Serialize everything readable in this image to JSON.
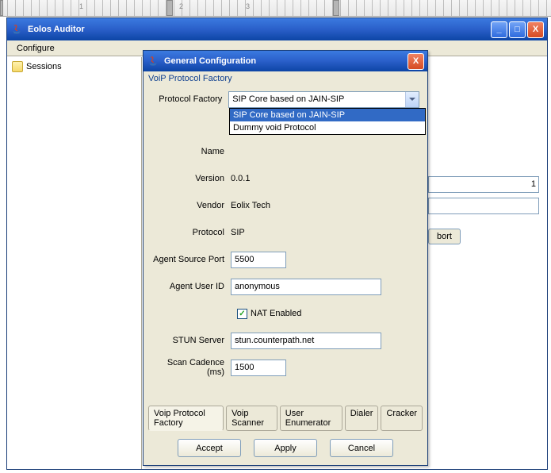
{
  "app": {
    "title": "Eolos Auditor",
    "menu": {
      "configure": "Configure"
    }
  },
  "tree": {
    "sessions": "Sessions"
  },
  "dialog": {
    "title": "General Configuration",
    "group": "VoiP Protocol Factory",
    "labels": {
      "protocol_factory": "Protocol Factory",
      "name": "Name",
      "version": "Version",
      "vendor": "Vendor",
      "protocol": "Protocol",
      "agent_source_port": "Agent Source Port",
      "agent_user_id": "Agent User ID",
      "nat_enabled": "NAT Enabled",
      "stun_server": "STUN Server",
      "scan_cadence": "Scan Cadence (ms)"
    },
    "values": {
      "protocol_factory": "SIP Core based on JAIN-SIP",
      "version": "0.0.1",
      "vendor": "Eolix Tech",
      "protocol": "SIP",
      "agent_source_port": "5500",
      "agent_user_id": "anonymous",
      "nat_enabled": true,
      "stun_server": "stun.counterpath.net",
      "scan_cadence": "1500"
    },
    "dropdown_options": [
      "SIP Core based on JAIN-SIP",
      "Dummy void Protocol"
    ],
    "tabs": {
      "voip_factory": "Voip Protocol Factory",
      "voip_scanner": "Voip Scanner",
      "user_enum": "User Enumerator",
      "dialer": "Dialer",
      "cracker": "Cracker"
    },
    "buttons": {
      "accept": "Accept",
      "apply": "Apply",
      "cancel": "Cancel"
    }
  },
  "background": {
    "field1": "1",
    "abort": "bort"
  }
}
